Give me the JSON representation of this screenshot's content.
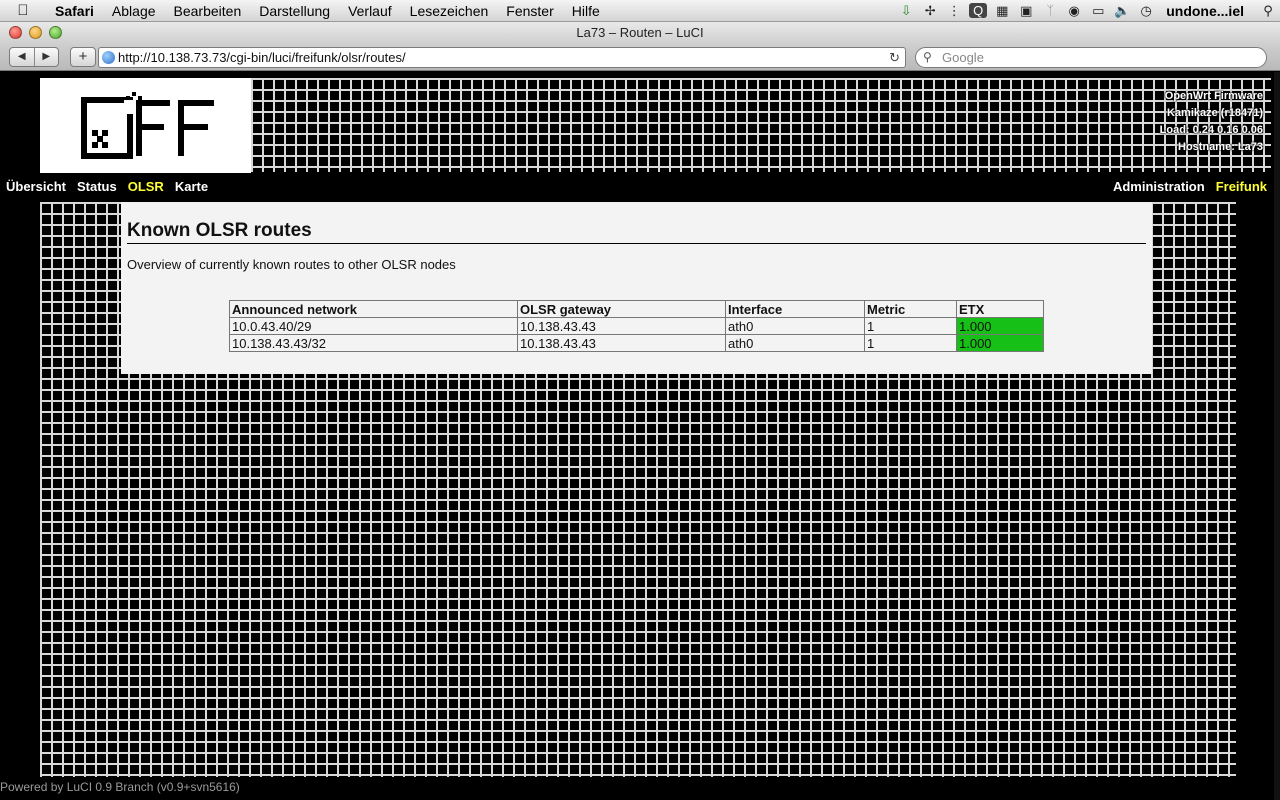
{
  "menubar": {
    "app": "Safari",
    "items": [
      "Ablage",
      "Bearbeiten",
      "Darstellung",
      "Verlauf",
      "Lesezeichen",
      "Fenster",
      "Hilfe"
    ],
    "user": "undone...iel"
  },
  "window": {
    "title": "La73 – Routen – LuCI"
  },
  "browser": {
    "url": "http://10.138.73.73/cgi-bin/luci/freifunk/olsr/routes/",
    "search_placeholder": "Google"
  },
  "header": {
    "firmware": "OpenWrt Firmware",
    "kernel": "Kamikaze (r18471)",
    "load": "Load: 0.24 0.16 0.06",
    "hostname": "Hostname: La73"
  },
  "nav": {
    "left": [
      "Übersicht",
      "Status",
      "OLSR",
      "Karte"
    ],
    "right": [
      "Administration",
      "Freifunk"
    ],
    "active_left": "OLSR",
    "active_right": "Freifunk"
  },
  "main": {
    "title": "Known OLSR routes",
    "description": "Overview of currently known routes to other OLSR nodes",
    "table": {
      "headers": [
        "Announced network",
        "OLSR gateway",
        "Interface",
        "Metric",
        "ETX"
      ],
      "rows": [
        [
          "10.0.43.40/29",
          "10.138.43.43",
          "ath0",
          "1",
          "1.000"
        ],
        [
          "10.138.43.43/32",
          "10.138.43.43",
          "ath0",
          "1",
          "1.000"
        ]
      ]
    }
  },
  "footer": "Powered by LuCI 0.9 Branch (v0.9+svn5616)",
  "colors": {
    "accent": "#ffff33",
    "etx_good": "#16c016"
  }
}
